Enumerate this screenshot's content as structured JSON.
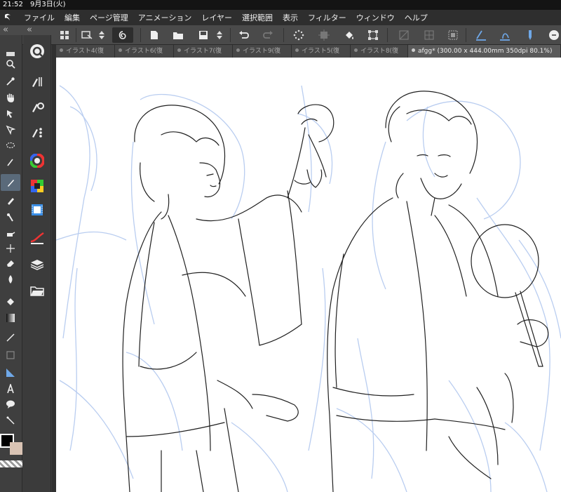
{
  "status_bar": {
    "time": "21:52",
    "date": "9月3日(火)"
  },
  "menu": {
    "app_icon": "clip-studio-icon",
    "items": [
      "ファイル",
      "編集",
      "ページ管理",
      "アニメーション",
      "レイヤー",
      "選択範囲",
      "表示",
      "フィルター",
      "ウィンドウ",
      "ヘルプ"
    ]
  },
  "command_bar": {
    "collapse_left": "«",
    "collapse_right": "«",
    "buttons": [
      "grid-icon",
      "transform-icon",
      "stepper-icon",
      "sync-icon",
      "new-file-icon",
      "open-folder-icon",
      "save-icon",
      "stepper-icon",
      "undo-icon",
      "redo-icon",
      "sparkle-icon",
      "crop-icon",
      "fill-icon",
      "transform-corners-icon",
      "ruler-off-icon",
      "ruler-grid-icon",
      "frame-icon",
      "ruler-icon",
      "ruler-snap-icon",
      "pen-snap-icon",
      "more-icon"
    ]
  },
  "tabs": [
    {
      "label": "イラスト4(復",
      "active": false
    },
    {
      "label": "イラスト6(復",
      "active": false
    },
    {
      "label": "イラスト7(復",
      "active": false
    },
    {
      "label": "イラスト9(復",
      "active": false
    },
    {
      "label": "イラスト5(復",
      "active": false
    },
    {
      "label": "イラスト8(復",
      "active": false
    },
    {
      "label": "afgg* (300.00 x 444.00mm 350dpi 80.1%)",
      "active": true
    }
  ],
  "tools": [
    "zoom-icon",
    "eyedropper-icon",
    "hand-icon",
    "move-icon",
    "select-icon",
    "lasso-icon",
    "pen-icon",
    "pencil-icon",
    "brush-icon",
    "eraser-icon",
    "airbrush-icon",
    "blend-icon",
    "fill-icon",
    "gradient-icon",
    "line-icon",
    "frame-icon",
    "ruler-icon",
    "text-icon",
    "balloon-icon",
    "correct-line-icon"
  ],
  "sub_tools": [
    "quick-access-icon",
    "sub-tool-pen-icon",
    "sub-tool-settings-icon",
    "sub-tool-detail-icon",
    "color-wheel-icon",
    "color-set-icon",
    "animation-timeline-icon",
    "navigator-icon",
    "layers-icon",
    "material-folder-icon"
  ],
  "colors": {
    "main": "#000000",
    "sub": "#d9c3b4",
    "accent": "#5a6a7a"
  },
  "canvas": {
    "sketch_color": "#b9cdf0",
    "lineart_color": "#202020"
  }
}
